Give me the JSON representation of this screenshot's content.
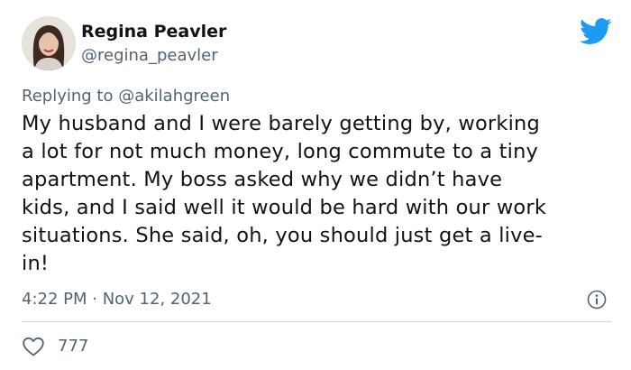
{
  "author": {
    "name": "Regina Peavler",
    "handle": "@regina_peavler"
  },
  "reply": {
    "prefix": "Replying to",
    "mention": "@akilahgreen"
  },
  "tweet": {
    "lines": [
      "My husband and I were barely getting by, working",
      "a lot for not much money, long commute to a tiny",
      "apartment. My boss asked why we didn’t have",
      "kids, and I said well it would be hard with our work",
      "situations. She said, oh, you should just get a live-",
      "in!"
    ]
  },
  "meta": {
    "timestamp": "4:22 PM · Nov 12, 2021"
  },
  "actions": {
    "like_count": "777"
  },
  "colors": {
    "brand": "#1d9bf0",
    "text": "#0f1419",
    "secondary": "#536471",
    "divider": "#cfd9de"
  },
  "icons": {
    "brand": "twitter-bird-icon",
    "info": "info-icon",
    "like": "heart-icon"
  }
}
